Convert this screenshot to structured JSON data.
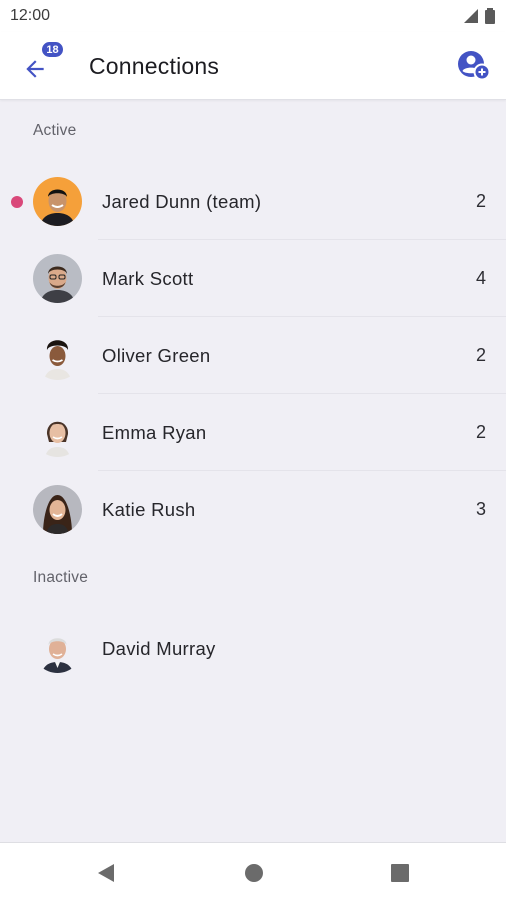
{
  "status_bar": {
    "time": "12:00"
  },
  "app_bar": {
    "title": "Connections",
    "back_badge": "18"
  },
  "sections": {
    "active": "Active",
    "inactive": "Inactive"
  },
  "active_contacts": [
    {
      "name": "Jared Dunn (team)",
      "count": "2",
      "unread": true
    },
    {
      "name": "Mark Scott",
      "count": "4",
      "unread": false
    },
    {
      "name": "Oliver Green",
      "count": "2",
      "unread": false
    },
    {
      "name": "Emma Ryan",
      "count": "2",
      "unread": false
    },
    {
      "name": "Katie Rush",
      "count": "3",
      "unread": false
    }
  ],
  "inactive_contacts": [
    {
      "name": "David Murray"
    }
  ],
  "colors": {
    "accent": "#4353c4",
    "unread_dot": "#d9487a",
    "background": "#f0eff5"
  }
}
